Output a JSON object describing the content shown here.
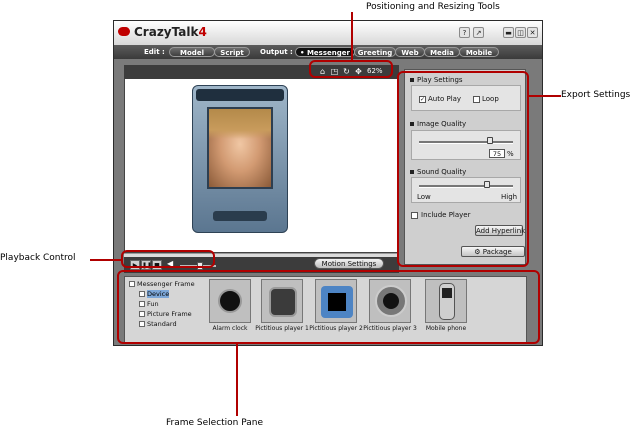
{
  "callouts": {
    "positioning": "Positioning and Resizing Tools",
    "export": "Export Settings",
    "playback": "Playback Control",
    "frames": "Frame Selection Pane"
  },
  "app": {
    "title_text": "CrazyTalk",
    "title_version": "4",
    "help_glyph": "?",
    "tool_glyph": "↗",
    "window_buttons": [
      "▬",
      "◫",
      "✕"
    ]
  },
  "menu": {
    "edit_label": "Edit :",
    "output_label": "Output :",
    "edit_tabs": [
      "Model",
      "Script"
    ],
    "output_tabs": [
      "• Messenger",
      "Greeting",
      "Web",
      "Media",
      "Mobile"
    ],
    "active_tab": "• Messenger"
  },
  "stage": {
    "zoom_text": "62%",
    "tool_icons": [
      "home-icon",
      "resize-icon",
      "rotate-icon",
      "move-icon"
    ]
  },
  "controls": {
    "play_glyph": "▶",
    "pause_glyph": "❚❚",
    "stop_glyph": "■",
    "volume_level": 0.55,
    "motion_settings_label": "Motion Settings"
  },
  "export": {
    "play_settings_title": "Play Settings",
    "auto_play_label": "Auto Play",
    "auto_play_checked": true,
    "loop_label": "Loop",
    "loop_checked": false,
    "image_quality_title": "Image Quality",
    "image_quality_value": "75",
    "image_quality_unit": "%",
    "image_quality_level": 0.75,
    "sound_quality_title": "Sound Quality",
    "sound_low_label": "Low",
    "sound_high_label": "High",
    "sound_quality_level": 0.72,
    "include_player_label": "Include Player",
    "include_player_checked": false,
    "add_hyperlink_label": "Add Hyperlink",
    "package_label": "Package"
  },
  "frames": {
    "tree_root": "Messenger Frame",
    "tree_items": [
      "Device",
      "Fun",
      "Picture Frame",
      "Standard"
    ],
    "selected_item": "Device",
    "thumbnails": [
      {
        "caption": "Alarm clock"
      },
      {
        "caption": "Pictitious player 1"
      },
      {
        "caption": "Pictitious player 2"
      },
      {
        "caption": "Pictitious player 3"
      },
      {
        "caption": "Mobile phone"
      }
    ]
  },
  "colors": {
    "annotation_red": "#b00000",
    "logo_red": "#c00000",
    "tree_selection": "#7da7d8"
  }
}
